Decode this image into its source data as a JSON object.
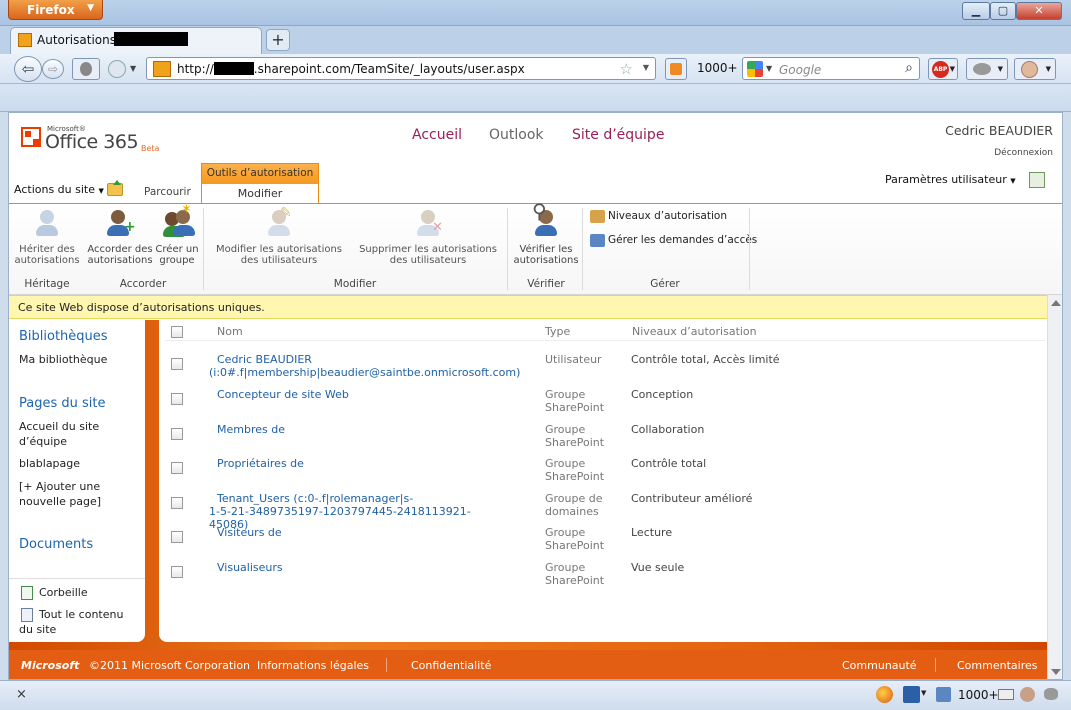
{
  "browser": {
    "app_button": "Firefox",
    "tab_title": "Autorisations :",
    "new_tab": "+",
    "url_prefix": "http://",
    "url_rest": ".sharepoint.com/TeamSite/_layouts/user.aspx",
    "feed_count": "1000+",
    "search_placeholder": "Google",
    "abp_label": "ABP",
    "close_x": "×",
    "status_count": "1000+"
  },
  "header": {
    "logo_small": "Microsoft®",
    "logo_main": "Office 365",
    "logo_beta": "Beta",
    "nav": [
      "Accueil",
      "Outlook",
      "Site d’équipe"
    ],
    "user_name": "Cedric BEAUDIER",
    "logout": "Déconnexion"
  },
  "ribbon": {
    "site_actions": "Actions du site",
    "browse": "Parcourir",
    "context_label": "Outils d’autorisation",
    "active_tab": "Modifier",
    "user_settings": "Paramètres utilisateur",
    "buttons": {
      "inherit": "Hériter des autorisations",
      "grant": "Accorder des autorisations",
      "create_group": "Créer un groupe",
      "edit_perms": "Modifier les autorisations des utilisateurs",
      "remove_perms": "Supprimer les autorisations des utilisateurs",
      "check_perms": "Vérifier les autorisations",
      "perm_levels": "Niveaux d’autorisation",
      "access_requests": "Gérer les demandes d’accès"
    },
    "groups": {
      "inheritance": "Héritage",
      "grant": "Accorder",
      "modify": "Modifier",
      "check": "Vérifier",
      "manage": "Gérer"
    }
  },
  "banner": "Ce site Web dispose d’autorisations uniques.",
  "leftnav": {
    "libraries_heading": "Bibliothèques",
    "libraries": [
      "Ma bibliothèque"
    ],
    "pages_heading": "Pages du site",
    "pages": [
      "Accueil du site d’équipe",
      "blablapage",
      "[+ Ajouter une nouvelle page]"
    ],
    "documents_heading": "Documents",
    "recycle_bin": "Corbeille",
    "all_content": "Tout le contenu du site"
  },
  "table": {
    "headers": {
      "name": "Nom",
      "type": "Type",
      "levels": "Niveaux d’autorisation"
    },
    "rows": [
      {
        "name": "Cedric BEAUDIER",
        "name2": "(i:0#.f|membership|beaudier@saintbe.onmicrosoft.com)",
        "type": "Utilisateur",
        "type2": "",
        "levels": "Contrôle total, Accès limité"
      },
      {
        "name": "Concepteur de site Web",
        "name2": "",
        "type": "Groupe",
        "type2": "SharePoint",
        "levels": "Conception"
      },
      {
        "name": "Membres de",
        "name2": "",
        "type": "Groupe",
        "type2": "SharePoint",
        "levels": "Collaboration"
      },
      {
        "name": "Propriétaires de",
        "name2": "",
        "type": "Groupe",
        "type2": "SharePoint",
        "levels": "Contrôle total"
      },
      {
        "name": "Tenant_Users (c:0-.f|rolemanager|s-",
        "name2": "1-5-21-3489735197-1203797445-2418113921-45086)",
        "type": "Groupe de",
        "type2": "domaines",
        "levels": "Contributeur amélioré"
      },
      {
        "name": "Visiteurs de",
        "name2": "",
        "type": "Groupe",
        "type2": "SharePoint",
        "levels": "Lecture"
      },
      {
        "name": "Visualiseurs",
        "name2": "",
        "type": "Groupe",
        "type2": "SharePoint",
        "levels": "Vue seule"
      }
    ]
  },
  "footer": {
    "brand": "Microsoft",
    "copyright": "©2011 Microsoft Corporation",
    "legal": "Informations légales",
    "privacy": "Confidentialité",
    "community": "Communauté",
    "feedback": "Commentaires"
  },
  "colors": {
    "accent": "#e35e12",
    "link": "#2061a6",
    "banner": "#fff6b0"
  }
}
